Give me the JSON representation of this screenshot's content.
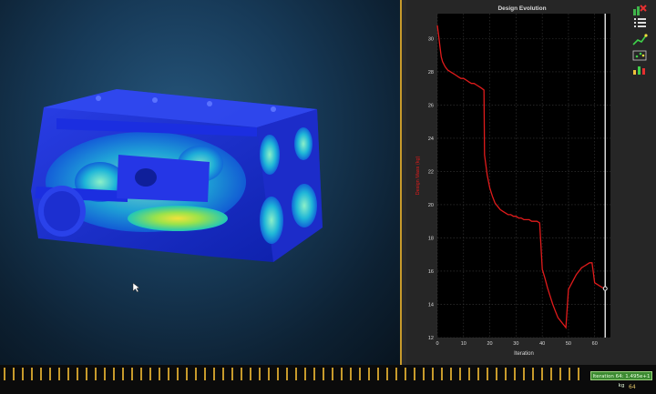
{
  "viewport": {
    "label": "3D design viewport",
    "bg_color": "#173a58"
  },
  "chart_panel": {
    "colors": {
      "background": "#000000",
      "line": "#e01b1b",
      "grid": "#3a3a3a",
      "ylabel": "#e01b1b",
      "current_marker": "#d8d8d8"
    }
  },
  "toolbar": {
    "icons": [
      "chart-close-icon",
      "list-icon",
      "line-chart-icon",
      "scatter-chart-icon",
      "bar-chart-icon"
    ]
  },
  "timeline": {
    "badge_text": "Iteration 64: 1.495e+1 kg",
    "frame_number": "64",
    "accent_color": "#c79a2b"
  },
  "chart_data": {
    "type": "line",
    "title": "Design Evolution",
    "xlabel": "Iteration",
    "ylabel": "Design Mass (kg)",
    "xlim": [
      0,
      66
    ],
    "ylim": [
      12,
      31.5
    ],
    "xticks": [
      0,
      10,
      20,
      30,
      40,
      50,
      60
    ],
    "yticks": [
      12,
      14,
      16,
      18,
      20,
      22,
      24,
      26,
      28,
      30
    ],
    "current_iteration": 64,
    "series": [
      {
        "x": [
          0,
          0.5,
          1,
          1.5,
          2,
          3,
          4,
          5,
          6,
          7,
          8,
          9,
          10,
          11,
          12,
          13,
          14,
          15,
          16,
          17,
          17.8,
          18,
          19,
          20,
          21,
          22,
          23,
          24,
          25,
          26,
          27,
          28,
          29,
          30,
          31,
          32,
          33,
          34,
          35,
          36,
          37,
          38,
          39,
          40,
          41,
          42,
          43,
          44,
          45,
          46,
          47,
          48,
          49,
          50,
          51,
          52,
          53,
          54,
          55,
          56,
          57,
          58,
          59,
          60,
          61,
          62,
          63,
          64
        ],
        "y": [
          30.8,
          30.2,
          29.5,
          28.9,
          28.6,
          28.3,
          28.1,
          28.0,
          27.9,
          27.8,
          27.7,
          27.6,
          27.6,
          27.5,
          27.4,
          27.3,
          27.3,
          27.2,
          27.1,
          27.0,
          26.9,
          23.0,
          21.8,
          21.0,
          20.5,
          20.1,
          19.9,
          19.7,
          19.6,
          19.5,
          19.4,
          19.4,
          19.3,
          19.3,
          19.2,
          19.2,
          19.1,
          19.1,
          19.1,
          19.0,
          19.0,
          19.0,
          18.9,
          16.1,
          15.6,
          15.0,
          14.5,
          14.0,
          13.6,
          13.2,
          13.0,
          12.8,
          12.6,
          14.9,
          15.2,
          15.5,
          15.8,
          16.0,
          16.2,
          16.3,
          16.4,
          16.5,
          16.5,
          15.3,
          15.2,
          15.1,
          15.0,
          14.95
        ]
      }
    ]
  }
}
